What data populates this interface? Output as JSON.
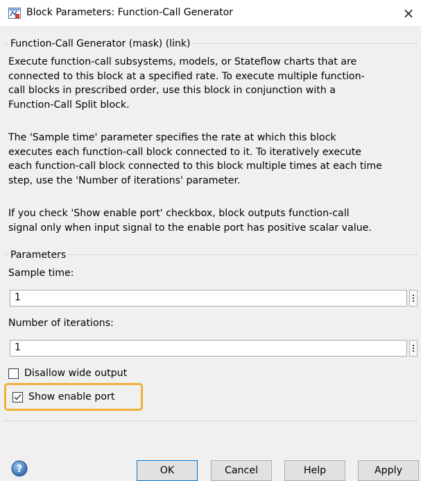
{
  "window": {
    "title": "Block Parameters: Function-Call Generator",
    "close_glyph": "×"
  },
  "mask": {
    "group_title": "Function-Call Generator (mask) (link)",
    "paragraphs": [
      "Execute function-call subsystems, models, or Stateflow charts that are\nconnected to this block at a specified rate. To execute multiple function-\ncall blocks in prescribed order, use this block in conjunction with a\nFunction-Call Split block.",
      "The 'Sample time' parameter specifies the rate at which this block\nexecutes each function-call block connected to it. To iteratively execute\neach function-call block connected to this block multiple times at each time\nstep,  use the 'Number of iterations' parameter.",
      "If you check 'Show enable port' checkbox, block outputs function-call\nsignal only when input signal to the enable port has positive scalar value."
    ]
  },
  "parameters": {
    "group_title": "Parameters",
    "sample_time": {
      "label": "Sample time:",
      "value": "1"
    },
    "iterations": {
      "label": "Number of iterations:",
      "value": "1"
    },
    "disallow_wide_output": {
      "label": "Disallow wide output",
      "checked": false
    },
    "show_enable_port": {
      "label": "Show enable port",
      "checked": true,
      "highlight_color": "#f0b038"
    }
  },
  "buttons": {
    "ok": "OK",
    "cancel": "Cancel",
    "help": "Help",
    "apply": "Apply"
  },
  "colors": {
    "background": "#f0f0f0",
    "default_button_border": "#0078d7",
    "highlight": "#f0b038"
  },
  "icons": {
    "app": "simulink-block-icon",
    "help": "help-question-icon",
    "more": "vertical-dots-icon"
  }
}
